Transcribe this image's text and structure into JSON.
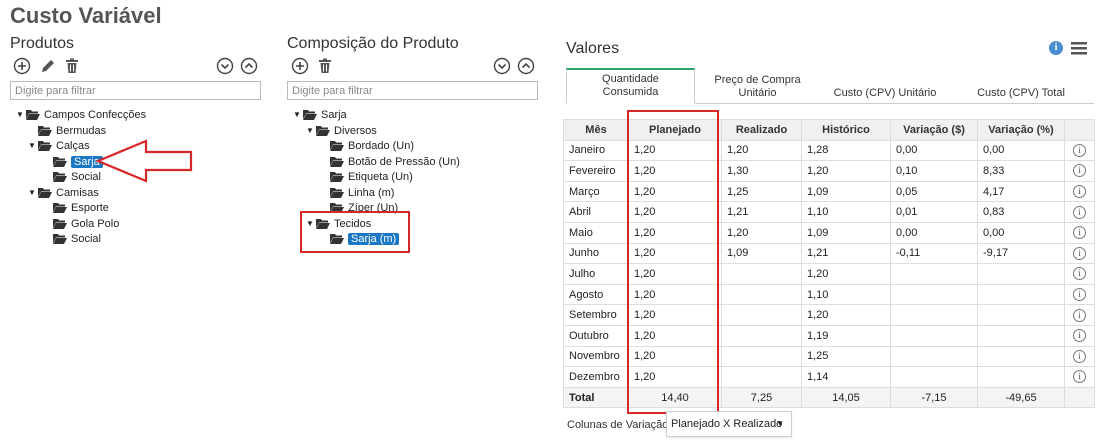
{
  "page": {
    "title": "Custo Variável"
  },
  "produtos": {
    "title": "Produtos",
    "filter_placeholder": "Digite para filtrar",
    "tree": [
      "Campos Confecções",
      "Bermudas",
      "Calças",
      "Sarja",
      "Social",
      "Camisas",
      "Esporte",
      "Gola Polo",
      "Social"
    ]
  },
  "composicao": {
    "title": "Composição do Produto",
    "filter_placeholder": "Digite para filtrar",
    "tree": [
      "Sarja",
      "Diversos",
      "Bordado (Un)",
      "Botão de Pressão (Un)",
      "Etiqueta (Un)",
      "Linha (m)",
      "Zíper (Un)",
      "Tecidos",
      "Sarja (m)"
    ]
  },
  "valores": {
    "title": "Valores",
    "tabs": [
      {
        "label": "Quantidade\nConsumida"
      },
      {
        "label": "Preço de Compra\nUnitário"
      },
      {
        "label": "Custo (CPV) Unitário"
      },
      {
        "label": "Custo (CPV) Total"
      }
    ],
    "columns": [
      "Mês",
      "Planejado",
      "Realizado",
      "Histórico",
      "Variação ($)",
      "Variação (%)"
    ],
    "rows": [
      [
        "Janeiro",
        "1,20",
        "1,20",
        "1,28",
        "0,00",
        "0,00"
      ],
      [
        "Fevereiro",
        "1,20",
        "1,30",
        "1,20",
        "0,10",
        "8,33"
      ],
      [
        "Março",
        "1,20",
        "1,25",
        "1,09",
        "0,05",
        "4,17"
      ],
      [
        "Abril",
        "1,20",
        "1,21",
        "1,10",
        "0,01",
        "0,83"
      ],
      [
        "Maio",
        "1,20",
        "1,20",
        "1,09",
        "0,00",
        "0,00"
      ],
      [
        "Junho",
        "1,20",
        "1,09",
        "1,21",
        "-0,11",
        "-9,17"
      ],
      [
        "Julho",
        "1,20",
        "",
        "1,20",
        "",
        ""
      ],
      [
        "Agosto",
        "1,20",
        "",
        "1,10",
        "",
        ""
      ],
      [
        "Setembro",
        "1,20",
        "",
        "1,20",
        "",
        ""
      ],
      [
        "Outubro",
        "1,20",
        "",
        "1,19",
        "",
        ""
      ],
      [
        "Novembro",
        "1,20",
        "",
        "1,25",
        "",
        ""
      ],
      [
        "Dezembro",
        "1,20",
        "",
        "1,14",
        "",
        ""
      ]
    ],
    "variation_colors": [
      "none",
      "red",
      "red",
      "red",
      "none",
      "green",
      "none",
      "none",
      "none",
      "none",
      "none",
      "none"
    ],
    "total": [
      "Total",
      "14,40",
      "7,25",
      "14,05",
      "-7,15",
      "-49,65"
    ],
    "variation_label": "Colunas de Variação:",
    "variation_selected": "Planejado X Realizado"
  },
  "colors": {
    "accent": "#1a77c4",
    "highlight_red": "#d62828",
    "negative": "#e0182d",
    "positive": "#2c9a2c",
    "tab_active": "#2aa26a"
  }
}
